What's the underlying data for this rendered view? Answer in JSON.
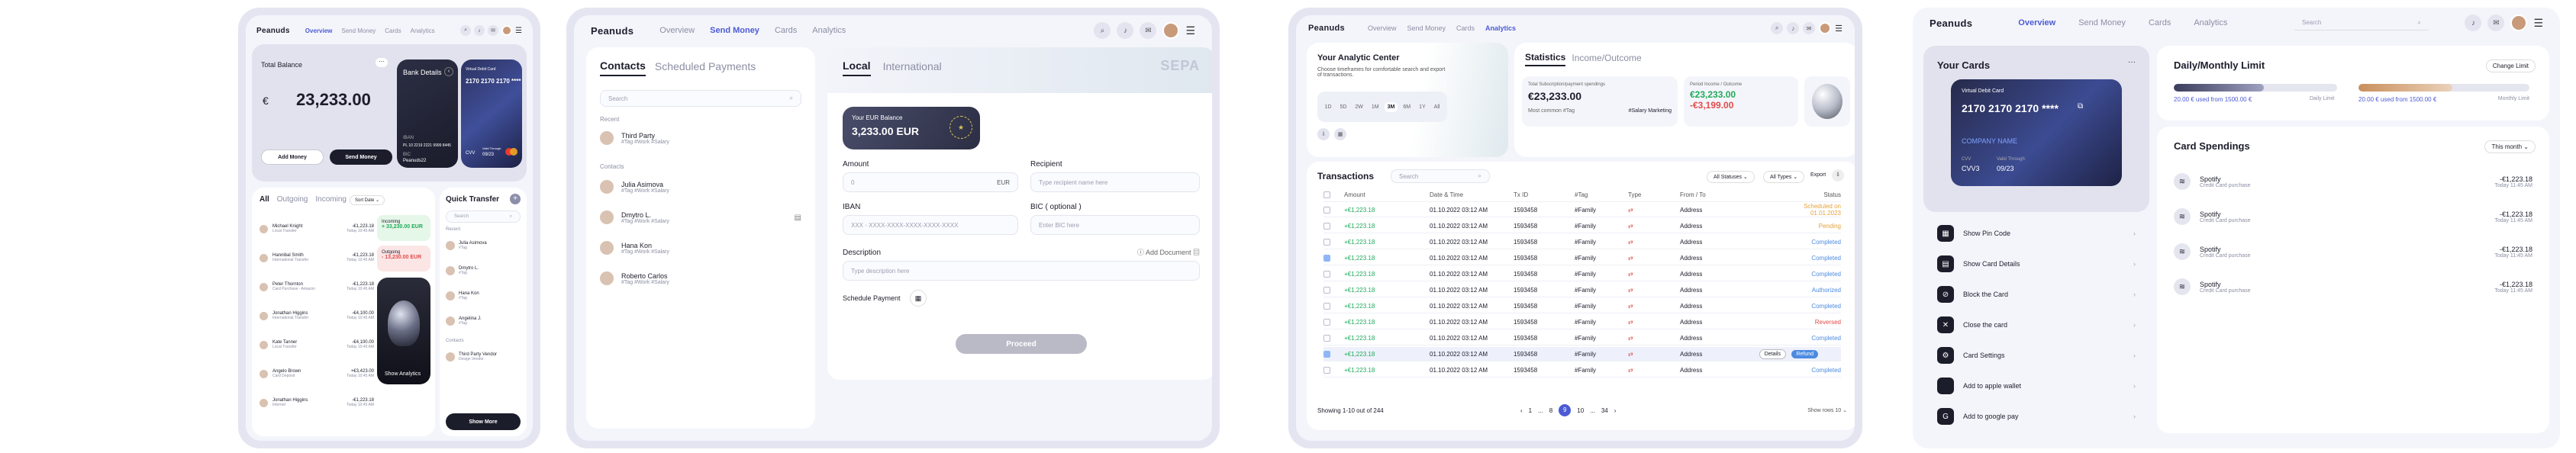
{
  "nav": {
    "logo": "Peanuds",
    "links": [
      "Overview",
      "Send Money",
      "Cards",
      "Analytics"
    ]
  },
  "p1": {
    "balance_label": "Total Balance",
    "currency_symbol": "€",
    "balance": "23,233.00",
    "add_money": "Add Money",
    "send_money": "Send Money",
    "bank_details": "Bank Details",
    "iban_label": "IBAN",
    "iban_value": "PL 10 2219 2221 9999 8445",
    "bic_label": "BIC",
    "bic_value": "Peanuds22",
    "vcard_label": "Virtual Debit Card",
    "vcard_number": "2170 2170 2170 ****",
    "cvv_label": "CVV",
    "valid_label": "Valid Through",
    "valid_value": "09/23",
    "tabs": [
      "All",
      "Outgoing",
      "Incoming"
    ],
    "sort": "Sort Date",
    "transactions": [
      {
        "name": "Michael Knight",
        "sub": "Local Transfer",
        "amount": "-€1,223.18",
        "date": "Today 10:45 AM"
      },
      {
        "name": "Hannibal Smith",
        "sub": "International Transfer",
        "amount": "-€1,223.18",
        "date": "Today 10:45 AM"
      },
      {
        "name": "Peter Thornton",
        "sub": "Card Purchase - Amazon",
        "amount": "-€1,223.18",
        "date": "Today 10:45 AM"
      },
      {
        "name": "Jonathan Higgins",
        "sub": "International Transfer",
        "amount": "-€4,100.00",
        "date": "Today 10:45 AM"
      },
      {
        "name": "Kate Tanner",
        "sub": "Local Transfer",
        "amount": "-€4,100.00",
        "date": "Today 10:45 AM"
      },
      {
        "name": "Angelo Brown",
        "sub": "Card Deposit",
        "amount": "+€3,423.00",
        "date": "Today 10:45 AM"
      },
      {
        "name": "Jonathan Higgins",
        "sub": "Internet",
        "amount": "-€1,223.18",
        "date": "Today 10:45 AM"
      }
    ],
    "incoming_label": "Incoming",
    "incoming_value": "+ 33,230.00 EUR",
    "outgoing_label": "Outgoing",
    "outgoing_value": "- 13,230.00 EUR",
    "show_analytics": "Show Analytics",
    "quick_transfer": "Quick Transfer",
    "search": "Search",
    "recent": "Recent",
    "contacts": "Contacts",
    "qt_recent": [
      {
        "name": "Julia Asimova",
        "sub": "#Tag"
      },
      {
        "name": "Dmytro L.",
        "sub": "#Tag"
      },
      {
        "name": "Hana Kon",
        "sub": "#Tag"
      },
      {
        "name": "Angelina J.",
        "sub": "#Tag"
      }
    ],
    "qt_contact": {
      "name": "Third Party Vendor",
      "sub": "Design Vendor"
    },
    "show_more": "Show More"
  },
  "p2": {
    "tabs": [
      "Contacts",
      "Scheduled Payments"
    ],
    "search": "Search",
    "recent": "Recent",
    "contacts": "Contacts",
    "recent_items": [
      {
        "name": "Third Party",
        "tags": "#Tag #Work #Salary"
      }
    ],
    "contact_items": [
      {
        "name": "Julia Asimova",
        "tags": "#Tag #Work #Salary"
      },
      {
        "name": "Dmytro L.",
        "tags": "#Tag #Work #Salary"
      },
      {
        "name": "Hana Kon",
        "tags": "#Tag #Work #Salary"
      },
      {
        "name": "Roberto Carlos",
        "tags": "#Tag #Work #Salary"
      }
    ],
    "form_tabs": [
      "Local",
      "International"
    ],
    "sepa": "SEPA",
    "balance_label": "Your EUR Balance",
    "balance_value": "3,233.00 EUR",
    "amount_label": "Amount",
    "amount_placeholder": "0",
    "amount_currency": "EUR",
    "recipient_label": "Recipient",
    "recipient_placeholder": "Type recipient name here",
    "iban_label": "IBAN",
    "iban_placeholder": "XXX - XXXX-XXXX-XXXX-XXXX-XXXX",
    "bic_label": "BIC ( optional )",
    "bic_placeholder": "Enter BIC here",
    "desc_label": "Description",
    "add_document": "Add Document",
    "desc_placeholder": "Type description here",
    "schedule_label": "Schedule Payment",
    "proceed": "Proceed"
  },
  "p3": {
    "ac_title": "Your Analytic Center",
    "ac_sub": "Choose timeframes for comfortable search and export of transactions.",
    "timeframes": [
      "1D",
      "5D",
      "2W",
      "1M",
      "3M",
      "6M",
      "1Y",
      "All"
    ],
    "timeframe_active": "3M",
    "stat_tabs": [
      "Statistics",
      "Income/Outcome"
    ],
    "spend_label": "Total Subscription/payment spendings",
    "spend_value": "€23,233.00",
    "common_tag_label": "Most common #Tag",
    "common_tag": "#Salary Marketing",
    "period_label": "Period Income / Outcome",
    "period_in": "€23,233.00",
    "period_out": "-€3,199.00",
    "tx_title": "Transactions",
    "search": "Search",
    "filter1": "All Statuses",
    "filter2": "All Types",
    "export": "Export",
    "columns": [
      "Amount",
      "Date & Time",
      "Tx ID",
      "#Tag",
      "Type",
      "From / To",
      "Status"
    ],
    "rows": [
      {
        "amount": "+€1,223.18",
        "date": "01.10.2022 03:12 AM",
        "id": "1593458",
        "tag": "#Family",
        "party": "Address",
        "status": "Scheduled on 01.01.2023",
        "checked": false
      },
      {
        "amount": "+€1,223.18",
        "date": "01.10.2022 03:12 AM",
        "id": "1593458",
        "tag": "#Family",
        "party": "Address",
        "status": "Pending",
        "checked": false
      },
      {
        "amount": "+€1,223.18",
        "date": "01.10.2022 03:12 AM",
        "id": "1593458",
        "tag": "#Family",
        "party": "Address",
        "status": "Completed",
        "checked": false
      },
      {
        "amount": "+€1,223.18",
        "date": "01.10.2022 03:12 AM",
        "id": "1593458",
        "tag": "#Family",
        "party": "Address",
        "status": "Completed",
        "checked": true
      },
      {
        "amount": "+€1,223.18",
        "date": "01.10.2022 03:12 AM",
        "id": "1593458",
        "tag": "#Family",
        "party": "Address",
        "status": "Completed",
        "checked": false
      },
      {
        "amount": "+€1,223.18",
        "date": "01.10.2022 03:12 AM",
        "id": "1593458",
        "tag": "#Family",
        "party": "Address",
        "status": "Authorized",
        "checked": false
      },
      {
        "amount": "+€1,223.18",
        "date": "01.10.2022 03:12 AM",
        "id": "1593458",
        "tag": "#Family",
        "party": "Address",
        "status": "Completed",
        "checked": false
      },
      {
        "amount": "+€1,223.18",
        "date": "01.10.2022 03:12 AM",
        "id": "1593458",
        "tag": "#Family",
        "party": "Address",
        "status": "Reversed",
        "checked": false
      },
      {
        "amount": "+€1,223.18",
        "date": "01.10.2022 03:12 AM",
        "id": "1593458",
        "tag": "#Family",
        "party": "Address",
        "status": "Completed",
        "checked": false
      },
      {
        "amount": "+€1,223.18",
        "date": "01.10.2022 03:12 AM",
        "id": "1593458",
        "tag": "#Family",
        "party": "Address",
        "status": "Refund",
        "checked": true
      },
      {
        "amount": "+€1,223.18",
        "date": "01.10.2022 03:12 AM",
        "id": "1593458",
        "tag": "#Family",
        "party": "Address",
        "status": "Completed",
        "checked": false
      }
    ],
    "details_btn": "Details",
    "refund_btn": "Refund",
    "showing": "Showing 1-10 out of 244",
    "pages": [
      "1",
      "...",
      "8",
      "9",
      "10",
      "...",
      "34"
    ],
    "page_active": "9",
    "show_rows": "Show rows 10"
  },
  "p4": {
    "cards_title": "Your Cards",
    "vcard_label": "Virtual Debit Card",
    "vcard_number": "2170 2170 2170 ****",
    "company": "COMPANY NAME",
    "cvv_label": "CVV",
    "cvv_value": "CVV3",
    "valid_label": "Valid Through",
    "valid_value": "09/23",
    "menu": [
      "Show Pin Code",
      "Show Card Details",
      "Block the Card",
      "Close the card",
      "Card Settings",
      "Add to apple wallet",
      "Add to google pay"
    ],
    "menu_icons": [
      "▦",
      "▤",
      "⊘",
      "✕",
      "⚙",
      "",
      "G"
    ],
    "limit_title": "Daily/Monthly Limit",
    "change_limit": "Change Limit",
    "daily_used": "20.00 € used from 1500.00 €",
    "daily_label": "Daily Limit",
    "daily_ratio": 0.55,
    "monthly_used": "20.00 € used from 1500.00 €",
    "monthly_label": "Monthly Limit",
    "monthly_ratio": 0.55,
    "spend_title": "Card Spendings",
    "spend_filter": "This month",
    "spendings": [
      {
        "name": "Spotify",
        "sub": "Credit Card purchase",
        "amount": "-€1,223.18",
        "date": "Today 11:45 AM"
      },
      {
        "name": "Spotify",
        "sub": "Credit Card purchase",
        "amount": "-€1,223.18",
        "date": "Today 11:45 AM"
      },
      {
        "name": "Spotify",
        "sub": "Credit Card purchase",
        "amount": "-€1,223.18",
        "date": "Today 11:45 AM"
      },
      {
        "name": "Spotify",
        "sub": "Credit Card purchase",
        "amount": "-€1,223.18",
        "date": "Today 11:45 AM"
      }
    ]
  },
  "colors": {
    "accent": "#4c5bd4",
    "green": "#1faa59",
    "red": "#e14b4b",
    "dark": "#1c1d2b"
  }
}
